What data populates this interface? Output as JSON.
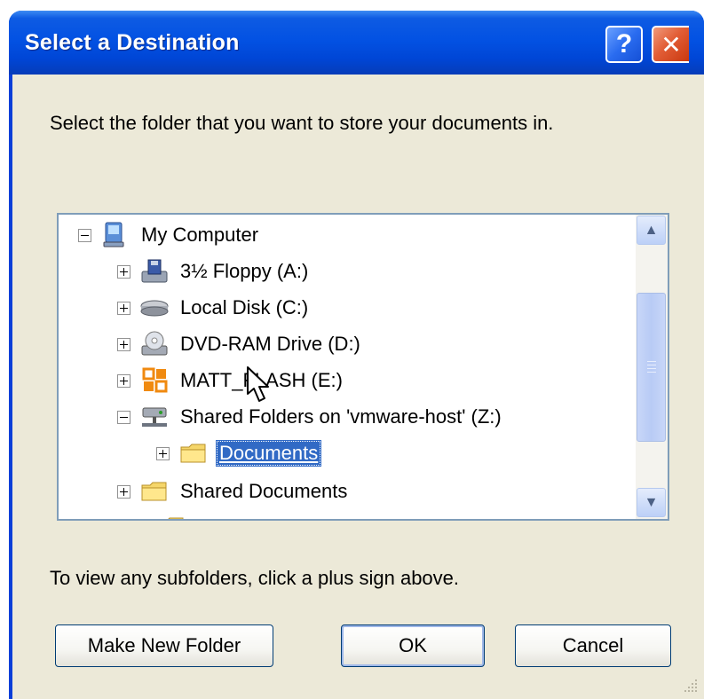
{
  "window": {
    "title": "Select a Destination",
    "help_button": "?",
    "close_button": "✕"
  },
  "instruction": "Select the folder that you want to store your documents in.",
  "tree": {
    "items": [
      {
        "label": "My Computer",
        "expander": "minus",
        "icon": "computer-icon",
        "level": 0
      },
      {
        "label": "3½ Floppy (A:)",
        "expander": "plus",
        "icon": "floppy-drive-icon",
        "level": 1
      },
      {
        "label": "Local Disk (C:)",
        "expander": "plus",
        "icon": "hard-disk-icon",
        "level": 1
      },
      {
        "label": "DVD-RAM Drive (D:)",
        "expander": "plus",
        "icon": "dvd-drive-icon",
        "level": 1
      },
      {
        "label": "MATT_FLASH (E:)",
        "expander": "plus",
        "icon": "removable-drive-icon",
        "level": 1
      },
      {
        "label": "Shared Folders on 'vmware-host' (Z:)",
        "expander": "minus",
        "icon": "network-drive-icon",
        "level": 1
      },
      {
        "label": "Documents",
        "expander": "plus",
        "icon": "folder-icon",
        "level": 2,
        "selected": true
      },
      {
        "label": "Shared Documents",
        "expander": "plus",
        "icon": "folder-icon",
        "level": 1
      }
    ]
  },
  "footer_text": "To view any subfolders, click a plus sign above.",
  "buttons": {
    "make_new_folder": "Make New Folder",
    "ok": "OK",
    "cancel": "Cancel"
  },
  "colors": {
    "titlebar": "#0352e3",
    "client": "#ece9d8",
    "selection": "#316ac5"
  }
}
